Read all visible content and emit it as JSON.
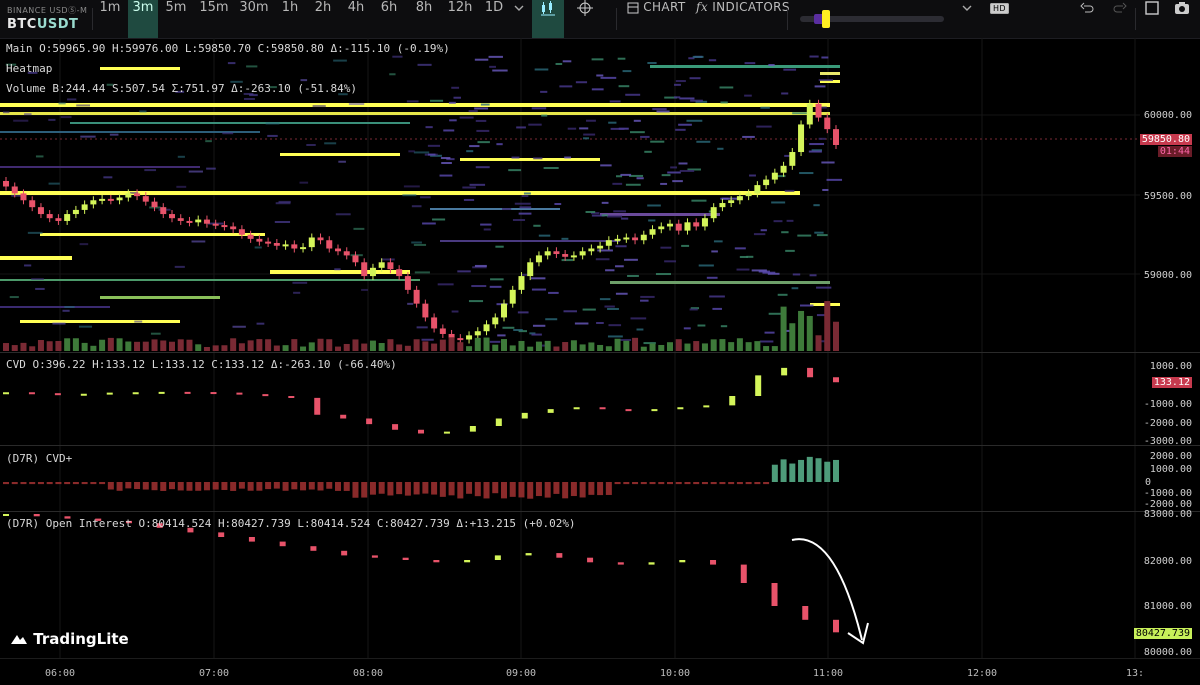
{
  "toolbar": {
    "exchange": "BINANCE USDⓈ-M",
    "symbol_base": "BTC",
    "symbol_quote": "USDT",
    "timeframes": [
      "1m",
      "3m",
      "5m",
      "15m",
      "30m",
      "1h",
      "2h",
      "4h",
      "6h",
      "8h",
      "12h",
      "1D"
    ],
    "active_timeframe": "3m",
    "chart_label": "CHART",
    "indicators_label": "INDICATORS",
    "hd_label": "HD"
  },
  "main_pane": {
    "label": "Main",
    "stats": "O:59965.90 H:59976.00 L:59850.70 C:59850.80 Δ:-115.10 (-0.19%)",
    "heatmap_label": "Heatmap",
    "volume_label": "Volume",
    "volume_stats": "B:244.44 S:507.54 Σ:751.97 Δ:-263.10 (-51.84%)",
    "price_axis": [
      "60000.00",
      "59500.00",
      "59000.00"
    ],
    "last_price": "59850.80",
    "countdown": "01:44"
  },
  "cvd_pane": {
    "label": "CVD",
    "stats": "O:396.22 H:133.12 L:133.12 C:133.12 Δ:-263.10 (-66.40%)",
    "axis": [
      "1000.00",
      "-1000.00",
      "-2000.00",
      "-3000.00"
    ],
    "last": "133.12"
  },
  "cvdplus_pane": {
    "label": "(D7R) CVD+",
    "axis": [
      "2000.00",
      "1000.00",
      "0",
      "-1000.00",
      "-2000.00"
    ]
  },
  "oi_pane": {
    "label": "(D7R) Open Interest",
    "stats": "O:80414.524 H:80427.739 L:80414.524 C:80427.739 Δ:+13.215 (+0.02%)",
    "axis": [
      "83000.00",
      "82000.00",
      "81000.00",
      "80000.00"
    ],
    "last": "80427.739"
  },
  "time_axis": [
    "06:00",
    "07:00",
    "08:00",
    "09:00",
    "10:00",
    "11:00",
    "12:00",
    "13:"
  ],
  "brand": "TradingLite",
  "colors": {
    "up": "#d4f55a",
    "down": "#e8536a",
    "heat_hi": "#ffff55",
    "toolbar_active": "#1f4a40"
  },
  "chart_data": {
    "type": "candlestick",
    "timeframe": "3m",
    "x": [
      "05:45",
      "05:48",
      "05:51",
      "05:54",
      "05:57",
      "06:00",
      "06:03",
      "06:06",
      "06:09",
      "06:12",
      "06:15",
      "06:18",
      "06:21",
      "06:24",
      "06:27",
      "06:30",
      "06:33",
      "06:36",
      "06:39",
      "06:42",
      "06:45",
      "06:48",
      "06:51",
      "06:54",
      "06:57",
      "07:00",
      "07:03",
      "07:06",
      "07:09",
      "07:12",
      "07:15",
      "07:18",
      "07:21",
      "07:24",
      "07:27",
      "07:30",
      "07:33",
      "07:36",
      "07:39",
      "07:42",
      "07:45",
      "07:48",
      "07:51",
      "07:54",
      "07:57",
      "08:00",
      "08:03",
      "08:06",
      "08:09",
      "08:12",
      "08:15",
      "08:18",
      "08:21",
      "08:24",
      "08:27",
      "08:30",
      "08:33",
      "08:36",
      "08:39",
      "08:42",
      "08:45",
      "08:48",
      "08:51",
      "08:54",
      "08:57",
      "09:00",
      "09:03",
      "09:06",
      "09:09",
      "09:12",
      "09:15",
      "09:18",
      "09:21",
      "09:24",
      "09:27",
      "09:30",
      "09:33",
      "09:36",
      "09:39",
      "09:42",
      "09:45",
      "09:48",
      "09:51",
      "09:54",
      "09:57",
      "10:00",
      "10:03",
      "10:06",
      "10:09",
      "10:12",
      "10:15",
      "10:18",
      "10:21",
      "10:24",
      "10:27",
      "10:30",
      "10:33",
      "10:36",
      "10:39",
      "10:42",
      "10:45",
      "10:48",
      "10:51",
      "10:54",
      "10:57",
      "11:00",
      "11:03"
    ],
    "close": [
      59550,
      59500,
      59450,
      59400,
      59350,
      59320,
      59300,
      59350,
      59380,
      59420,
      59450,
      59460,
      59450,
      59470,
      59500,
      59480,
      59440,
      59400,
      59350,
      59320,
      59300,
      59290,
      59310,
      59280,
      59270,
      59260,
      59240,
      59200,
      59170,
      59150,
      59140,
      59120,
      59130,
      59100,
      59110,
      59180,
      59160,
      59100,
      59080,
      59050,
      59000,
      58900,
      58960,
      59000,
      58950,
      58900,
      58800,
      58700,
      58600,
      58520,
      58480,
      58450,
      58440,
      58470,
      58500,
      58550,
      58600,
      58700,
      58800,
      58900,
      59000,
      59050,
      59080,
      59060,
      59040,
      59050,
      59080,
      59100,
      59120,
      59160,
      59170,
      59180,
      59160,
      59200,
      59240,
      59260,
      59280,
      59230,
      59290,
      59260,
      59320,
      59400,
      59430,
      59450,
      59480,
      59500,
      59560,
      59600,
      59650,
      59700,
      59800,
      60000,
      60150,
      60050,
      59966,
      59851
    ],
    "cvd_close": [
      -400,
      -450,
      -500,
      -480,
      -420,
      -400,
      -380,
      -390,
      -420,
      -500,
      -600,
      -700,
      -1600,
      -1800,
      -2100,
      -2400,
      -2600,
      -2500,
      -2200,
      -1800,
      -1500,
      -1300,
      -1200,
      -1300,
      -1350,
      -1300,
      -1200,
      -1100,
      -600,
      500,
      900,
      400,
      133.12
    ],
    "oi_close": [
      83000,
      82950,
      82900,
      82850,
      82800,
      82700,
      82600,
      82500,
      82400,
      82300,
      82200,
      82100,
      82050,
      82000,
      81950,
      82000,
      82100,
      82150,
      82050,
      81950,
      81900,
      81950,
      82000,
      81900,
      81500,
      81000,
      80700,
      80427.739
    ],
    "title": "",
    "ylabel": "",
    "ylim": [
      58400,
      60250
    ]
  }
}
